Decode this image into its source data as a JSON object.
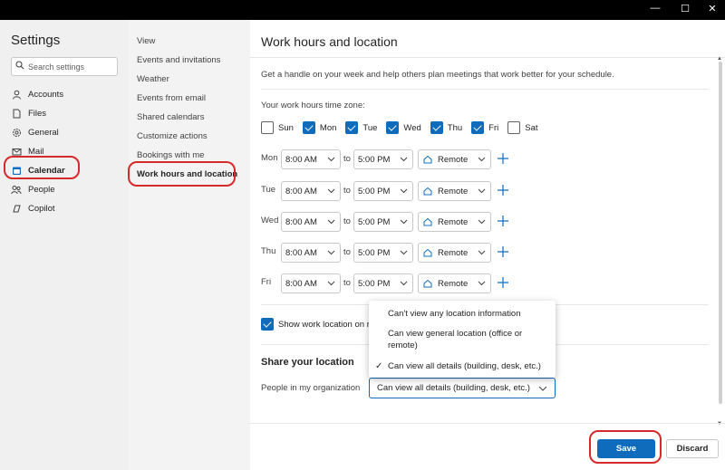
{
  "window": {
    "minimize": "—",
    "maximize": "☐",
    "close": "✕"
  },
  "sidebar": {
    "title": "Settings",
    "search_placeholder": "Search settings",
    "items": [
      {
        "label": "Accounts",
        "icon": "person-icon"
      },
      {
        "label": "Files",
        "icon": "file-icon"
      },
      {
        "label": "General",
        "icon": "gear-icon"
      },
      {
        "label": "Mail",
        "icon": "mail-icon"
      },
      {
        "label": "Calendar",
        "icon": "calendar-icon",
        "active": true
      },
      {
        "label": "People",
        "icon": "people-icon"
      },
      {
        "label": "Copilot",
        "icon": "copilot-icon"
      }
    ]
  },
  "subnav": {
    "items": [
      {
        "label": "View"
      },
      {
        "label": "Events and invitations"
      },
      {
        "label": "Weather"
      },
      {
        "label": "Events from email"
      },
      {
        "label": "Shared calendars"
      },
      {
        "label": "Customize actions"
      },
      {
        "label": "Bookings with me"
      },
      {
        "label": "Work hours and location",
        "active": true
      }
    ]
  },
  "main": {
    "title": "Work hours and location",
    "description": "Get a handle on your week and help others plan meetings that work better for your schedule.",
    "timezone_label": "Your work hours time zone:",
    "days": [
      {
        "label": "Sun",
        "checked": false
      },
      {
        "label": "Mon",
        "checked": true
      },
      {
        "label": "Tue",
        "checked": true
      },
      {
        "label": "Wed",
        "checked": true
      },
      {
        "label": "Thu",
        "checked": true
      },
      {
        "label": "Fri",
        "checked": true
      },
      {
        "label": "Sat",
        "checked": false
      }
    ],
    "to_label": "to",
    "rows": [
      {
        "day": "Mon",
        "start": "8:00 AM",
        "end": "5:00 PM",
        "location": "Remote"
      },
      {
        "day": "Tue",
        "start": "8:00 AM",
        "end": "5:00 PM",
        "location": "Remote"
      },
      {
        "day": "Wed",
        "start": "8:00 AM",
        "end": "5:00 PM",
        "location": "Remote"
      },
      {
        "day": "Thu",
        "start": "8:00 AM",
        "end": "5:00 PM",
        "location": "Remote"
      },
      {
        "day": "Fri",
        "start": "8:00 AM",
        "end": "5:00 PM",
        "location": "Remote"
      }
    ],
    "show_location_label": "Show work location on m",
    "show_location_checked": true,
    "share_title": "Share your location",
    "people_label": "People in my organization",
    "people_value": "Can view all details (building, desk, etc.)",
    "dropdown_options": [
      {
        "label": "Can't view any location information",
        "selected": false
      },
      {
        "label": "Can view general location (office or remote)",
        "selected": false
      },
      {
        "label": "Can view all details (building, desk, etc.)",
        "selected": true
      }
    ],
    "save_label": "Save",
    "discard_label": "Discard"
  },
  "colors": {
    "accent": "#0f6cbd",
    "annotation": "#d62a2a"
  }
}
